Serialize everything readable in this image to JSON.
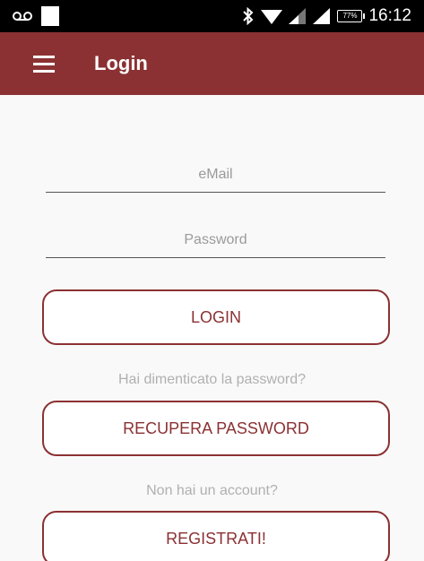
{
  "status_bar": {
    "left_icons": [
      "voicemail-icon",
      "notification-square-icon"
    ],
    "right_icons": [
      "bluetooth-icon",
      "wifi-icon",
      "signal-icon",
      "signal-2-icon",
      "battery-icon"
    ],
    "battery_text": "77%",
    "time": "16:12"
  },
  "app_bar": {
    "title": "Login",
    "menu_icon": "hamburger-menu-icon",
    "background": "#8b3133"
  },
  "form": {
    "email_placeholder": "eMail",
    "email_value": "",
    "password_placeholder": "Password",
    "password_value": "",
    "login_label": "LOGIN",
    "forgot_text": "Hai dimenticato la password?",
    "recover_label": "RECUPERA PASSWORD",
    "no_account_text": "Non hai un account?",
    "register_label": "REGISTRATI!"
  },
  "colors": {
    "accent": "#8b3133",
    "hint": "#b0b0b0"
  }
}
